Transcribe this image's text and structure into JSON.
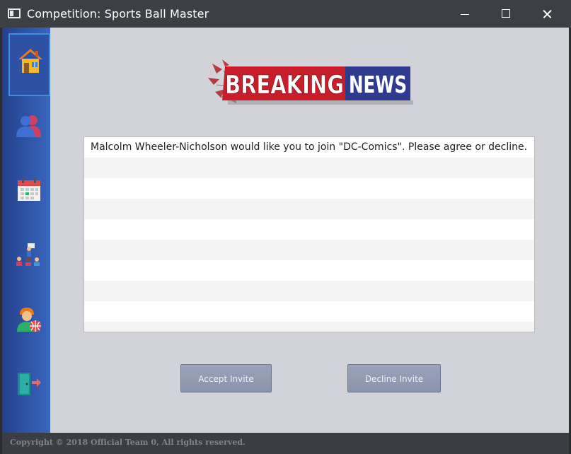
{
  "window": {
    "title": "Competition: Sports Ball Master",
    "app_icon": "window-icon",
    "controls": [
      "minimize-icon",
      "maximize-icon",
      "close-icon"
    ]
  },
  "sidebar": {
    "items": [
      {
        "name": "home",
        "icon": "house-icon",
        "active": true
      },
      {
        "name": "team",
        "icon": "people-icon",
        "active": false
      },
      {
        "name": "calendar",
        "icon": "calendar-icon",
        "active": false
      },
      {
        "name": "coach",
        "icon": "presentation-icon",
        "active": false
      },
      {
        "name": "player",
        "icon": "basketball-player-icon",
        "active": false
      },
      {
        "name": "exit",
        "icon": "exit-door-icon",
        "active": false
      }
    ]
  },
  "logo": {
    "word1": "BREAKING",
    "word2": "NEWS"
  },
  "messages": [
    "Malcolm Wheeler-Nicholson would like you to join \"DC-Comics\". Please agree or decline.",
    "",
    "",
    "",
    "",
    "",
    "",
    "",
    "",
    ""
  ],
  "buttons": {
    "accept": "Accept Invite",
    "decline": "Decline Invite"
  },
  "footer": {
    "copyright": "Copyright © 2018 Official Team 0, All rights reserved."
  },
  "colors": {
    "sidebar": "#2f55a8",
    "content_bg": "#d2d3d8",
    "button": "#9aa3b8",
    "logo_red": "#c81e2a",
    "logo_blue": "#2e3b8f"
  }
}
